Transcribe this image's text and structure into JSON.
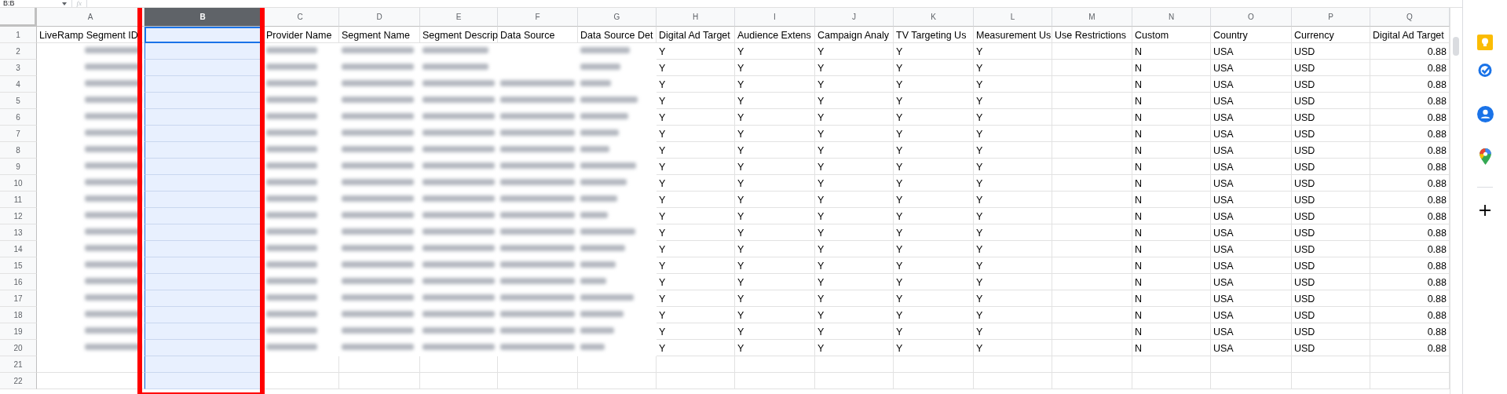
{
  "toolbar": {
    "name_box": "B:B",
    "formula_icon": "fx"
  },
  "columns": [
    {
      "label": "A",
      "selected": false
    },
    {
      "label": "B",
      "selected": true
    },
    {
      "label": "C",
      "selected": false
    },
    {
      "label": "D",
      "selected": false
    },
    {
      "label": "E",
      "selected": false
    },
    {
      "label": "F",
      "selected": false
    },
    {
      "label": "G",
      "selected": false
    },
    {
      "label": "H",
      "selected": false
    },
    {
      "label": "I",
      "selected": false
    },
    {
      "label": "J",
      "selected": false
    },
    {
      "label": "K",
      "selected": false
    },
    {
      "label": "L",
      "selected": false
    },
    {
      "label": "M",
      "selected": false
    },
    {
      "label": "N",
      "selected": false
    },
    {
      "label": "O",
      "selected": false
    },
    {
      "label": "P",
      "selected": false
    },
    {
      "label": "Q",
      "selected": false
    }
  ],
  "rows": [
    {
      "number": "1",
      "blurred": false,
      "cells": {
        "A": "LiveRamp Segment ID",
        "C": "Provider Name",
        "D": "Segment Name",
        "E": "Segment Descrip",
        "F": "Data Source",
        "G": "Data Source Det",
        "H": "Digital Ad Target",
        "I": "Audience Extens",
        "J": "Campaign Analy",
        "K": "TV Targeting Us",
        "L": "Measurement Us",
        "M": "Use Restrictions",
        "N": "Custom",
        "O": "Country",
        "P": "Currency",
        "Q": "Digital Ad Target"
      }
    },
    {
      "number": "2",
      "blurred": true,
      "cells": {
        "H": "Y",
        "I": "Y",
        "J": "Y",
        "K": "Y",
        "L": "Y",
        "N": "N",
        "O": "USA",
        "P": "USD",
        "Q": "0.88"
      }
    },
    {
      "number": "3",
      "blurred": true,
      "cells": {
        "H": "Y",
        "I": "Y",
        "J": "Y",
        "K": "Y",
        "L": "Y",
        "N": "N",
        "O": "USA",
        "P": "USD",
        "Q": "0.88"
      }
    },
    {
      "number": "4",
      "blurred": true,
      "cells": {
        "H": "Y",
        "I": "Y",
        "J": "Y",
        "K": "Y",
        "L": "Y",
        "N": "N",
        "O": "USA",
        "P": "USD",
        "Q": "0.88"
      }
    },
    {
      "number": "5",
      "blurred": true,
      "cells": {
        "H": "Y",
        "I": "Y",
        "J": "Y",
        "K": "Y",
        "L": "Y",
        "N": "N",
        "O": "USA",
        "P": "USD",
        "Q": "0.88"
      }
    },
    {
      "number": "6",
      "blurred": true,
      "cells": {
        "H": "Y",
        "I": "Y",
        "J": "Y",
        "K": "Y",
        "L": "Y",
        "N": "N",
        "O": "USA",
        "P": "USD",
        "Q": "0.88"
      }
    },
    {
      "number": "7",
      "blurred": true,
      "cells": {
        "H": "Y",
        "I": "Y",
        "J": "Y",
        "K": "Y",
        "L": "Y",
        "N": "N",
        "O": "USA",
        "P": "USD",
        "Q": "0.88"
      }
    },
    {
      "number": "8",
      "blurred": true,
      "cells": {
        "H": "Y",
        "I": "Y",
        "J": "Y",
        "K": "Y",
        "L": "Y",
        "N": "N",
        "O": "USA",
        "P": "USD",
        "Q": "0.88"
      }
    },
    {
      "number": "9",
      "blurred": true,
      "cells": {
        "H": "Y",
        "I": "Y",
        "J": "Y",
        "K": "Y",
        "L": "Y",
        "N": "N",
        "O": "USA",
        "P": "USD",
        "Q": "0.88"
      }
    },
    {
      "number": "10",
      "blurred": true,
      "cells": {
        "H": "Y",
        "I": "Y",
        "J": "Y",
        "K": "Y",
        "L": "Y",
        "N": "N",
        "O": "USA",
        "P": "USD",
        "Q": "0.88"
      }
    },
    {
      "number": "11",
      "blurred": true,
      "cells": {
        "H": "Y",
        "I": "Y",
        "J": "Y",
        "K": "Y",
        "L": "Y",
        "N": "N",
        "O": "USA",
        "P": "USD",
        "Q": "0.88"
      }
    },
    {
      "number": "12",
      "blurred": true,
      "cells": {
        "H": "Y",
        "I": "Y",
        "J": "Y",
        "K": "Y",
        "L": "Y",
        "N": "N",
        "O": "USA",
        "P": "USD",
        "Q": "0.88"
      }
    },
    {
      "number": "13",
      "blurred": true,
      "cells": {
        "H": "Y",
        "I": "Y",
        "J": "Y",
        "K": "Y",
        "L": "Y",
        "N": "N",
        "O": "USA",
        "P": "USD",
        "Q": "0.88"
      }
    },
    {
      "number": "14",
      "blurred": true,
      "cells": {
        "H": "Y",
        "I": "Y",
        "J": "Y",
        "K": "Y",
        "L": "Y",
        "N": "N",
        "O": "USA",
        "P": "USD",
        "Q": "0.88"
      }
    },
    {
      "number": "15",
      "blurred": true,
      "cells": {
        "H": "Y",
        "I": "Y",
        "J": "Y",
        "K": "Y",
        "L": "Y",
        "N": "N",
        "O": "USA",
        "P": "USD",
        "Q": "0.88"
      }
    },
    {
      "number": "16",
      "blurred": true,
      "cells": {
        "H": "Y",
        "I": "Y",
        "J": "Y",
        "K": "Y",
        "L": "Y",
        "N": "N",
        "O": "USA",
        "P": "USD",
        "Q": "0.88"
      }
    },
    {
      "number": "17",
      "blurred": true,
      "cells": {
        "H": "Y",
        "I": "Y",
        "J": "Y",
        "K": "Y",
        "L": "Y",
        "N": "N",
        "O": "USA",
        "P": "USD",
        "Q": "0.88"
      }
    },
    {
      "number": "18",
      "blurred": true,
      "cells": {
        "H": "Y",
        "I": "Y",
        "J": "Y",
        "K": "Y",
        "L": "Y",
        "N": "N",
        "O": "USA",
        "P": "USD",
        "Q": "0.88"
      }
    },
    {
      "number": "19",
      "blurred": true,
      "cells": {
        "H": "Y",
        "I": "Y",
        "J": "Y",
        "K": "Y",
        "L": "Y",
        "N": "N",
        "O": "USA",
        "P": "USD",
        "Q": "0.88"
      }
    },
    {
      "number": "20",
      "blurred": true,
      "cells": {
        "H": "Y",
        "I": "Y",
        "J": "Y",
        "K": "Y",
        "L": "Y",
        "N": "N",
        "O": "USA",
        "P": "USD",
        "Q": "0.88"
      }
    },
    {
      "number": "21",
      "blurred": false,
      "cells": {}
    },
    {
      "number": "22",
      "blurred": false,
      "cells": {}
    }
  ]
}
